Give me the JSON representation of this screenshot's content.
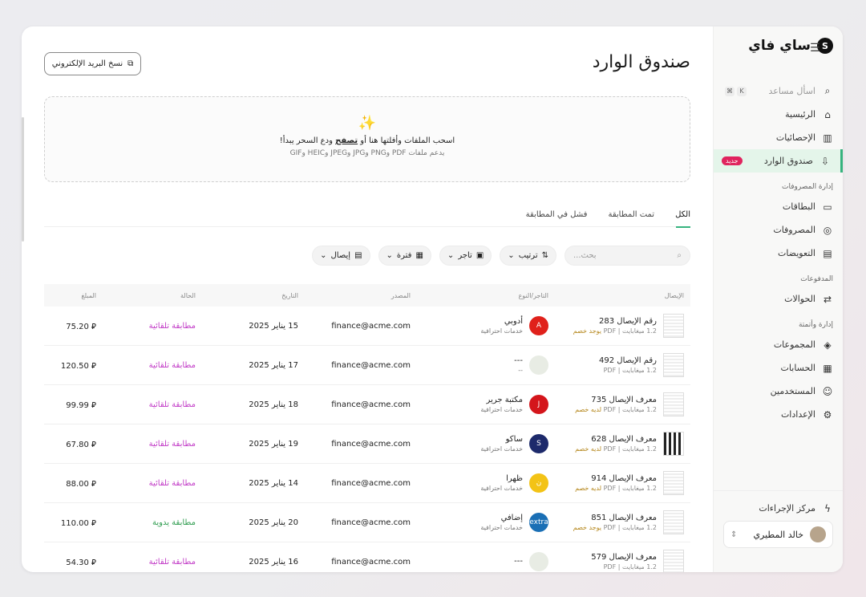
{
  "brand": {
    "name": "ساي فاي"
  },
  "sidebar": {
    "assistant": {
      "label": "اسأل مساعد",
      "keys": [
        "⌘",
        "K"
      ]
    },
    "items_top": [
      {
        "label": "الرئيسية",
        "icon": "home-icon"
      },
      {
        "label": "الإحصائيات",
        "icon": "stats-icon"
      },
      {
        "label": "صندوق الوارد",
        "icon": "inbox-icon",
        "badge": "جديد",
        "active": true
      }
    ],
    "section_expenses": "إدارة المصروفات",
    "items_expenses": [
      {
        "label": "البطاقات",
        "icon": "card-icon"
      },
      {
        "label": "المصروفات",
        "icon": "coins-icon"
      },
      {
        "label": "التعويضات",
        "icon": "reimburse-icon"
      }
    ],
    "section_payments": "المدفوعات",
    "items_payments": [
      {
        "label": "الحوالات",
        "icon": "transfer-icon"
      }
    ],
    "section_admin": "إدارة وأتمتة",
    "items_admin": [
      {
        "label": "المجموعات",
        "icon": "layers-icon"
      },
      {
        "label": "الحسابات",
        "icon": "accounts-icon"
      },
      {
        "label": "المستخدمين",
        "icon": "users-icon"
      },
      {
        "label": "الإعدادات",
        "icon": "settings-icon"
      }
    ],
    "actions_center": "مركز الإجراءات",
    "user": {
      "name": "خالد المطيري"
    }
  },
  "main": {
    "title": "صندوق الوارد",
    "copy_email": "نسخ البريد الإلكتروني",
    "dropzone": {
      "line1_pre": "اسحب الملفات وأفلتها هنا أو ",
      "line1_link": "تصفح",
      "line1_post": " ودع السحر يبدأ!",
      "line2": "يدعم ملفات PDF وPNG وJPG وJPEG وHEIC وGIF"
    },
    "tabs": [
      "الكل",
      "تمت المطابقة",
      "فشل في المطابقة"
    ],
    "search_placeholder": "بحث...",
    "filters": [
      "ترتيب",
      "تاجر",
      "فترة",
      "إيصال"
    ],
    "columns": [
      "الإيصال",
      "التاجر/النوع",
      "المصدر",
      "التاريخ",
      "الحالة",
      "المبلغ"
    ]
  },
  "rows": [
    {
      "receipt": "رقم الإيصال 283",
      "meta": "1.2 ميغابايت | PDF",
      "discount": "يوجد خصم",
      "merchant": "أدوبي",
      "type": "خدمات احترافية",
      "logo_color": "#e0211b",
      "logo_text": "A",
      "source": "finance@acme.com",
      "date": "15 يناير 2025",
      "status": "مطابقة تلقائية",
      "status_kind": "auto",
      "amount": "75.20"
    },
    {
      "receipt": "رقم الإيصال 492",
      "meta": "1.2 ميغابايت | PDF",
      "discount": "",
      "merchant": "---",
      "type": "--",
      "logo_color": "#e8ece4",
      "logo_text": "",
      "source": "finance@acme.com",
      "date": "17 يناير 2025",
      "status": "مطابقة تلقائية",
      "status_kind": "auto",
      "amount": "120.50"
    },
    {
      "receipt": "معرف الإيصال 735",
      "meta": "1.2 ميغابايت | PDF",
      "discount": "لديه خصم",
      "merchant": "مكتبة جرير",
      "type": "خدمات احترافية",
      "logo_color": "#d4151b",
      "logo_text": "J",
      "source": "finance@acme.com",
      "date": "18 يناير 2025",
      "status": "مطابقة تلقائية",
      "status_kind": "auto",
      "amount": "99.99"
    },
    {
      "receipt": "معرف الإيصال 628",
      "meta": "1.2 ميغابايت | PDF",
      "discount": "لديه خصم",
      "merchant": "ساكو",
      "type": "خدمات احترافية",
      "logo_color": "#1d2a6b",
      "logo_text": "S",
      "source": "finance@acme.com",
      "date": "19 يناير 2025",
      "status": "مطابقة تلقائية",
      "status_kind": "auto",
      "amount": "67.80"
    },
    {
      "receipt": "معرف الإيصال 914",
      "meta": "1.2 ميغابايت | PDF",
      "discount": "لديه خصم",
      "merchant": "ظهرا",
      "type": "خدمات احترافية",
      "logo_color": "#f3c316",
      "logo_text": "ن",
      "source": "finance@acme.com",
      "date": "14 يناير 2025",
      "status": "مطابقة تلقائية",
      "status_kind": "auto",
      "amount": "88.00"
    },
    {
      "receipt": "معرف الإيصال 851",
      "meta": "1.2 ميغابايت | PDF",
      "discount": "يوجد خصم",
      "merchant": "إضافي",
      "type": "خدمات احترافية",
      "logo_color": "#1a6fb5",
      "logo_text": "extra",
      "source": "finance@acme.com",
      "date": "20 يناير 2025",
      "status": "مطابقة يدوية",
      "status_kind": "manual",
      "amount": "110.00"
    },
    {
      "receipt": "معرف الإيصال 579",
      "meta": "1.2 ميغابايت | PDF",
      "discount": "",
      "merchant": "---",
      "type": "",
      "logo_color": "#e8ece4",
      "logo_text": "",
      "source": "finance@acme.com",
      "date": "16 يناير 2025",
      "status": "مطابقة تلقائية",
      "status_kind": "auto",
      "amount": "54.30"
    }
  ],
  "colors": {
    "accent": "#36b37e",
    "auto": "#c23cc7",
    "manual": "#2f9c4f",
    "new_badge": "#e0245e"
  }
}
